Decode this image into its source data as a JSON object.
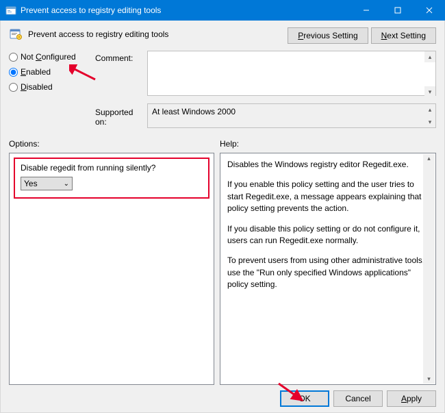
{
  "window": {
    "title": "Prevent access to registry editing tools"
  },
  "header": {
    "policy_title": "Prevent access to registry editing tools",
    "previous_button": "Previous Setting",
    "next_button": "Next Setting",
    "previous_ak": "P",
    "next_ak": "N"
  },
  "state": {
    "not_configured": "Not Configured",
    "not_configured_ak": "C",
    "enabled": "Enabled",
    "enabled_ak": "E",
    "disabled": "Disabled",
    "disabled_ak": "D",
    "selected": "enabled"
  },
  "labels": {
    "comment": "Comment:",
    "supported": "Supported on:",
    "options": "Options:",
    "help": "Help:"
  },
  "supported_text": "At least Windows 2000",
  "options": {
    "question": "Disable regedit from running silently?",
    "value": "Yes"
  },
  "help": {
    "p1": "Disables the Windows registry editor Regedit.exe.",
    "p2": "If you enable this policy setting and the user tries to start Regedit.exe, a message appears explaining that a policy setting prevents the action.",
    "p3": "If you disable this policy setting or do not configure it, users can run Regedit.exe normally.",
    "p4": "To prevent users from using other administrative tools, use the \"Run only specified Windows applications\" policy setting."
  },
  "buttons": {
    "ok": "OK",
    "cancel": "Cancel",
    "apply": "Apply",
    "apply_ak": "A"
  }
}
